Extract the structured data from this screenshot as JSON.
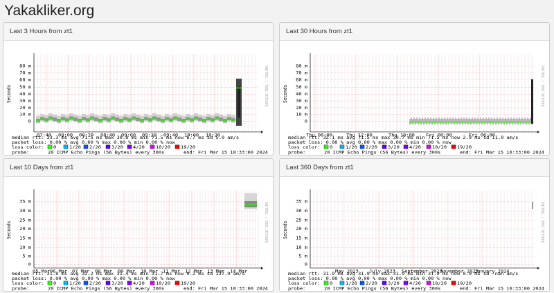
{
  "site": {
    "title": "Yakakliker.org"
  },
  "colors": {
    "loss_0": "#26ff00",
    "loss_1": "#00b8ff",
    "loss_2": "#0059ff",
    "loss_3": "#5e00ff",
    "loss_4": "#7e00ff",
    "loss_10": "#dd00ff",
    "loss_19": "#ff0000"
  },
  "panels": [
    {
      "title": "Last 3 Hours from zt1",
      "y_axis_label": "Seconds",
      "watermark": "RRDTOOL / TOBI OETIKER",
      "y_ticks": [
        "80 m",
        "70 m",
        "60 m",
        "50 m",
        "40 m",
        "30 m",
        "20 m",
        "10 m",
        "0"
      ],
      "x_ticks": [
        "07:40",
        "08:00",
        "08:20",
        "08:40",
        "09:00",
        "09:20",
        "09:40",
        "10:00",
        "10:20"
      ],
      "median_line": "median rtt:   33.3 ms avg  71.5 ms max  30.8 ms min  71.5 ms now  6.7 ms sd  5.0   am/s",
      "packet_loss_line": "packet loss: 0.00 % avg  0.00 % max  0.00 % min  0.00 % now",
      "loss_color_label": "loss color:",
      "loss_items": [
        "0",
        "1/20",
        "2/20",
        "3/20",
        "4/20",
        "10/20",
        "19/20"
      ],
      "probe_label": "probe:",
      "probe_text": "20 ICMP Echo Pings (56 Bytes) every 300s",
      "end_text": "end: Fri Mar 15 10:33:00 2024"
    },
    {
      "title": "Last 30 Hours from zt1",
      "y_axis_label": "Seconds",
      "watermark": "RRDTOOL / TOBI OETIKER",
      "y_ticks": [
        "80 m",
        "70 m",
        "60 m",
        "50 m",
        "40 m",
        "30 m",
        "20 m",
        "10 m",
        "0"
      ],
      "x_ticks": [
        "Thu 06:00",
        "Thu 12:00",
        "Thu 18:00",
        "Fri 00:00",
        "Fri 06:00"
      ],
      "median_line": "median rtt:   32.1 ms avg  71.5 ms max  30.7 ms min  71.5 ms now  2.9 ms sd  11.0   am/s",
      "packet_loss_line": "packet loss: 0.00 % avg  0.00 % max  0.00 % min  0.00 % now",
      "loss_color_label": "loss color:",
      "loss_items": [
        "0",
        "1/20",
        "2/20",
        "3/20",
        "4/20",
        "10/20",
        "19/20"
      ],
      "probe_label": "probe:",
      "probe_text": "20 ICMP Echo Pings (56 Bytes) every 300s",
      "end_text": "end: Fri Mar 15 10:33:00 2024"
    },
    {
      "title": "Last 10 Days from zt1",
      "y_axis_label": "Seconds",
      "watermark": "RRDTOOL / TOBI OETIKER",
      "y_ticks": [
        "35 m",
        "30 m",
        "25 m",
        "20 m",
        "15 m",
        "10 m",
        "5 m",
        "0"
      ],
      "x_ticks": [
        "05 Mar",
        "06 Mar",
        "07 Mar",
        "08 Mar",
        "09 Mar",
        "10 Mar",
        "11 Mar",
        "12 Mar",
        "13 Mar",
        "14 Mar"
      ],
      "median_line": "median rtt:   31.8 ms avg  32.2 ms max  31.4 ms min  31.7 ms now  0.2 ms sd  137.9   am/s",
      "packet_loss_line": "packet loss: 0.00 % avg  0.00 % max  0.00 % min  0.00 % now",
      "loss_color_label": "loss color:",
      "loss_items": [
        "0",
        "1/20",
        "2/20",
        "3/20",
        "4/20",
        "10/20",
        "19/20"
      ],
      "probe_label": "probe:",
      "probe_text": "20 ICMP Echo Pings (56 Bytes) every 300s",
      "end_text": "end: Fri Mar 15 10:33:00 2024"
    },
    {
      "title": "Last 360 Days from zt1",
      "y_axis_label": "Seconds",
      "watermark": "RRDTOOL / TOBI OETIKER",
      "y_ticks": [
        "35 m",
        "30 m",
        "25 m",
        "20 m",
        "15 m",
        "10 m",
        "5 m",
        "0"
      ],
      "x_ticks": [
        "May 2023",
        "July 2023",
        "September 2023",
        "November 2023",
        "January 2024"
      ],
      "median_line": "median rtt:   31.9 ms avg  31.9 ms max  31.9 ms min  31.9 ms now  0.0 ms sd  -nan   am/s",
      "packet_loss_line": "packet loss: 0.00 % avg  0.00 % max  0.00 % min  0.00 % now",
      "loss_color_label": "loss color:",
      "loss_items": [
        "0",
        "1/20",
        "2/20",
        "3/20",
        "4/20",
        "10/20",
        "19/20"
      ],
      "probe_label": "probe:",
      "probe_text": "20 ICMP Echo Pings (56 Bytes) every 300s",
      "end_text": "end: Fri Mar 15 10:33:00 2024"
    }
  ]
}
